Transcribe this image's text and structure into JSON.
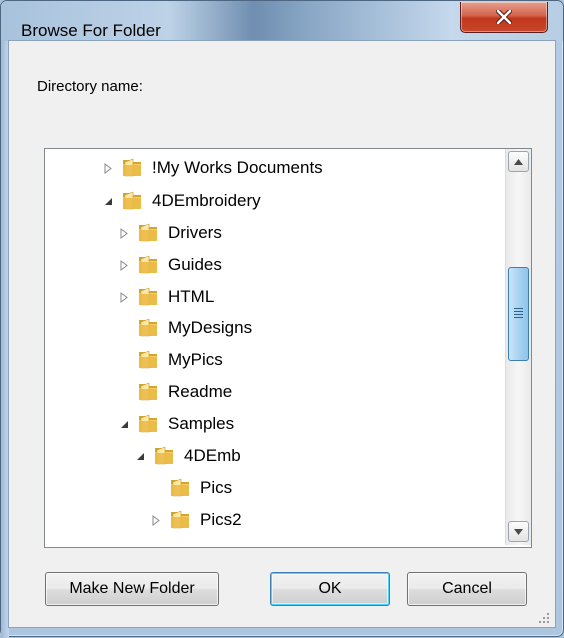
{
  "window": {
    "title": "Browse For Folder"
  },
  "dialog": {
    "directory_label": "Directory name:"
  },
  "tree": {
    "items": [
      {
        "label": "!My Works Documents",
        "expander": "collapsed"
      },
      {
        "label": "4DEmbroidery",
        "expander": "expanded"
      },
      {
        "label": "Drivers",
        "expander": "collapsed"
      },
      {
        "label": "Guides",
        "expander": "collapsed"
      },
      {
        "label": "HTML",
        "expander": "collapsed"
      },
      {
        "label": "MyDesigns",
        "expander": "none"
      },
      {
        "label": "MyPics",
        "expander": "none"
      },
      {
        "label": "Readme",
        "expander": "none"
      },
      {
        "label": "Samples",
        "expander": "expanded"
      },
      {
        "label": "4DEmb",
        "expander": "expanded"
      },
      {
        "label": "Pics",
        "expander": "none"
      },
      {
        "label": "Pics2",
        "expander": "collapsed"
      }
    ]
  },
  "buttons": {
    "make_new_folder": "Make New Folder",
    "ok": "OK",
    "cancel": "Cancel"
  },
  "icons": {
    "close": "close-icon",
    "folder": "folder-icon",
    "scroll_up": "scroll-up-arrow-icon",
    "scroll_down": "scroll-down-arrow-icon"
  },
  "colors": {
    "close_button": "#c8482c",
    "ok_focus": "#3c7fb1",
    "folder": "#e8b53c"
  }
}
